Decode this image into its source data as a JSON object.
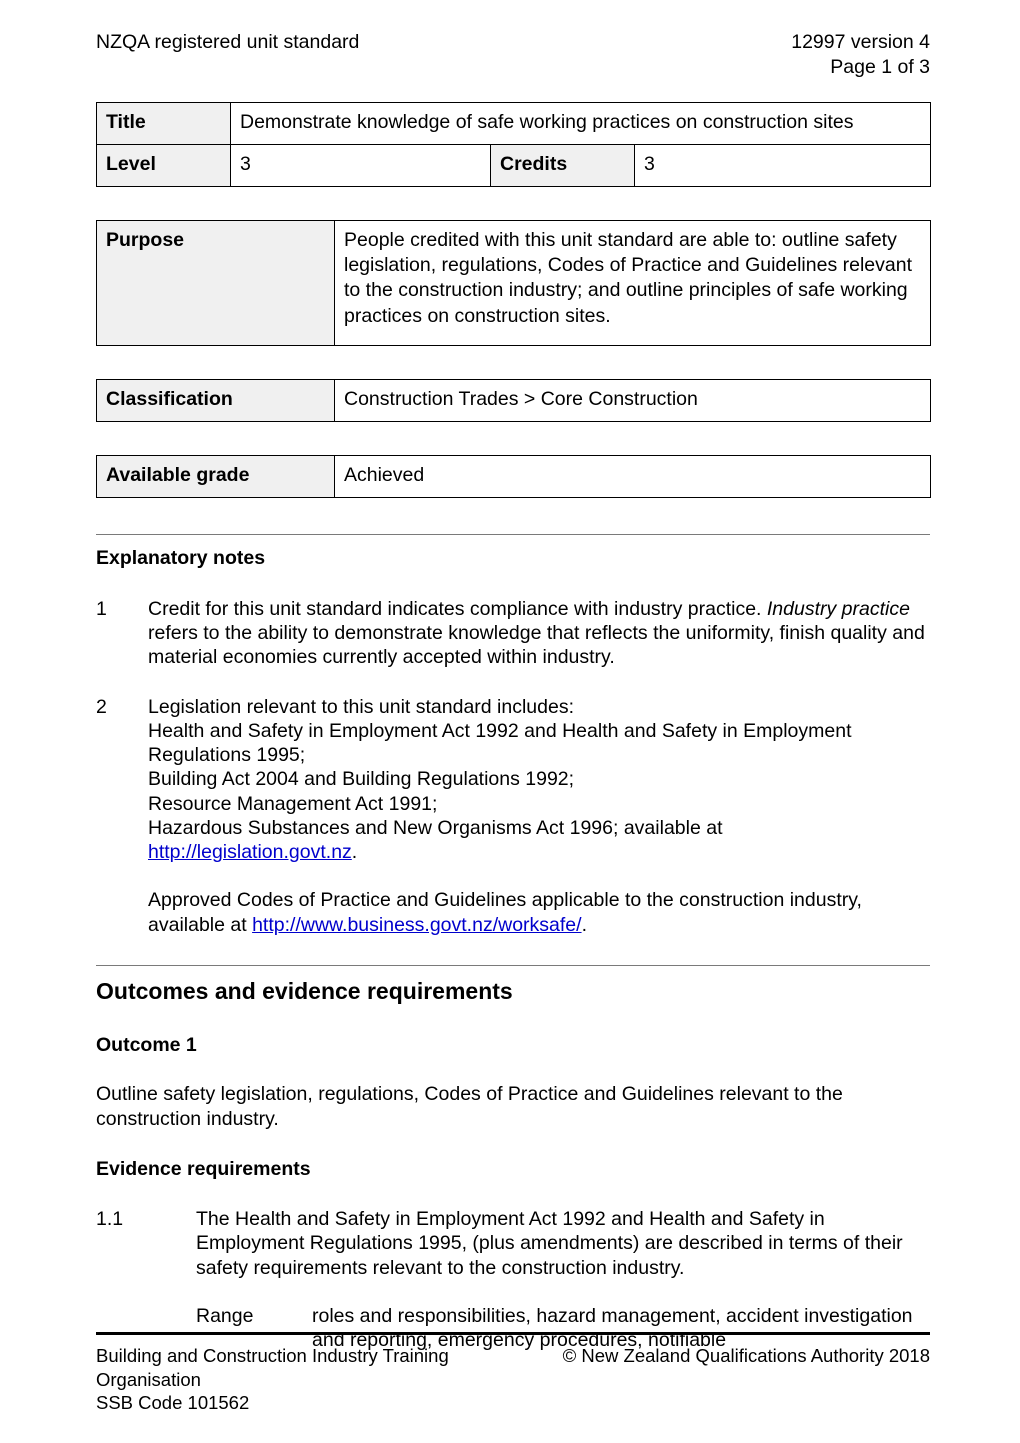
{
  "header": {
    "left": "NZQA registered unit standard",
    "standard_id": "12997 version 4",
    "page_label": "Page 1 of 3"
  },
  "title_table": {
    "title_label": "Title",
    "title_value": "Demonstrate knowledge of safe working practices on construction sites",
    "level_label": "Level",
    "level_value": "3",
    "credits_label": "Credits",
    "credits_value": "3"
  },
  "purpose_table": {
    "label": "Purpose",
    "value": "People credited with this unit standard are able to: outline safety legislation, regulations, Codes of Practice and Guidelines relevant to the construction industry; and outline principles of safe working practices on construction sites."
  },
  "classification_table": {
    "label": "Classification",
    "value": "Construction Trades > Core Construction"
  },
  "grade_table": {
    "label": "Available grade",
    "value": "Achieved"
  },
  "explanatory": {
    "heading": "Explanatory notes",
    "note1": {
      "num": "1",
      "text_part1": "Credit for this unit standard indicates compliance with industry practice.  ",
      "italic1": "Industry practice",
      "text_part2": " refers to the ability to demonstrate knowledge that reflects the uniformity, finish quality and material economies currently accepted within industry."
    },
    "note2": {
      "num": "2",
      "lead": "Legislation relevant to this unit standard includes:",
      "lines": [
        "Health and Safety in Employment Act 1992 and Health and Safety in Employment Regulations 1995;",
        "Building Act 2004 and Building Regulations 1992;",
        "Resource Management Act 1991;"
      ],
      "hsno_line": "Hazardous Substances and New Organisms Act 1996; available at ",
      "link1_text": "http://legislation.govt.nz",
      "link1_suffix": ".",
      "codes_prefix": "Approved Codes of Practice and Guidelines applicable to the construction industry, available at ",
      "link2_text": "http://www.business.govt.nz/worksafe/",
      "link2_suffix": "."
    }
  },
  "outcomes": {
    "heading": "Outcomes and evidence requirements",
    "outcome1_heading": "Outcome 1",
    "outcome1_text": "Outline safety legislation, regulations, Codes of Practice and Guidelines relevant to the construction industry.",
    "evidence_heading": "Evidence requirements",
    "ev_1_1": {
      "num": "1.1",
      "text": "The Health and Safety in Employment Act 1992 and Health and Safety in Employment Regulations 1995, (plus amendments) are described in terms of their safety requirements relevant to the construction industry."
    },
    "range_1_1": {
      "label": "Range",
      "text": "roles and responsibilities, hazard management, accident investigation and reporting, emergency procedures, notifiable"
    }
  },
  "footer": {
    "org_line1": "Building and Construction Industry Training",
    "org_line2": "Organisation",
    "ssb_code": "SSB Code 101562",
    "copyright": "© New Zealand Qualifications Authority 2018"
  }
}
